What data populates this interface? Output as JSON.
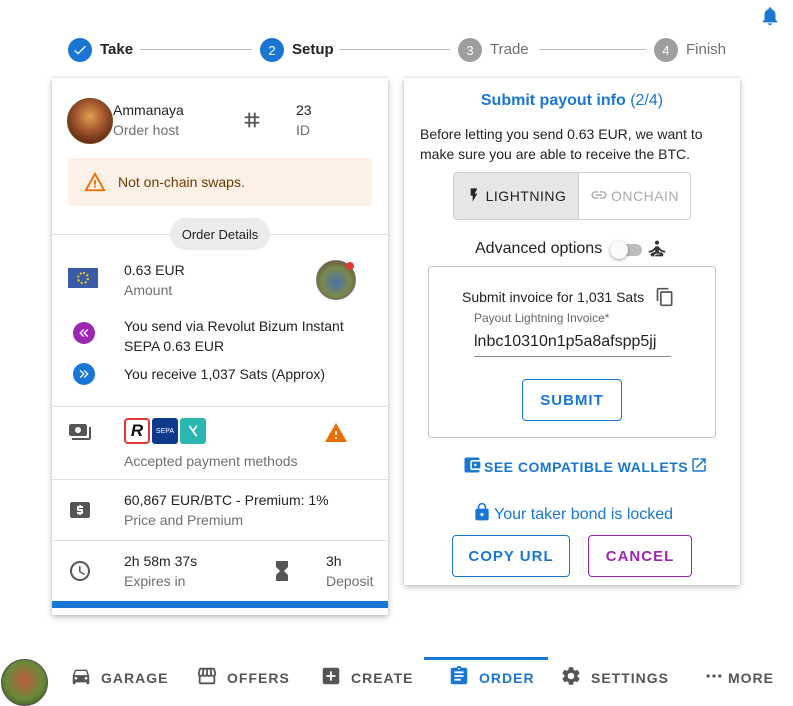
{
  "colors": {
    "primary": "#1976d2",
    "secondary": "#9c27b0",
    "warning": "#ed6c02",
    "muted": "#6f6f6f"
  },
  "stepper": {
    "steps": [
      {
        "number": "1",
        "label": "Take",
        "state": "done"
      },
      {
        "number": "2",
        "label": "Setup",
        "state": "active"
      },
      {
        "number": "3",
        "label": "Trade",
        "state": "pending"
      },
      {
        "number": "4",
        "label": "Finish",
        "state": "pending"
      }
    ]
  },
  "order": {
    "host_name": "Ammanaya",
    "host_label": "Order host",
    "id_value": "23",
    "id_label": "ID",
    "warning": "Not on-chain swaps.",
    "details_chip": "Order Details",
    "amount_value": "0.63 EUR",
    "amount_label": "Amount",
    "send_text": "You send via Revolut Bizum Instant SEPA 0.63 EUR",
    "receive_text": "You receive 1,037 Sats (Approx)",
    "payment_methods_label": "Accepted payment methods",
    "price_value": "60,867 EUR/BTC - Premium: 1%",
    "price_label": "Price and Premium",
    "expires_value": "2h 58m 37s",
    "expires_label": "Expires in",
    "deposit_value": "3h",
    "deposit_label": "Deposit"
  },
  "payout": {
    "title": "Submit payout info",
    "title_step": "(2/4)",
    "description": "Before letting you send 0.63 EUR, we want to make sure you are able to receive the BTC.",
    "lightning_label": "LIGHTNING",
    "onchain_label": "ONCHAIN",
    "advanced_label": "Advanced options",
    "invoice_heading": "Submit invoice for 1,031 Sats",
    "invoice_field_label": "Payout Lightning Invoice",
    "invoice_required": "*",
    "invoice_value": "lnbc10310n1p5a8afspp5jj",
    "submit_label": "SUBMIT",
    "wallets_label": "SEE COMPATIBLE WALLETS",
    "bond_text": "Your taker bond is locked",
    "copy_url_label": "COPY URL",
    "cancel_label": "CANCEL"
  },
  "nav": {
    "garage": "GARAGE",
    "offers": "OFFERS",
    "create": "CREATE",
    "order": "ORDER",
    "settings": "SETTINGS",
    "more": "MORE"
  }
}
